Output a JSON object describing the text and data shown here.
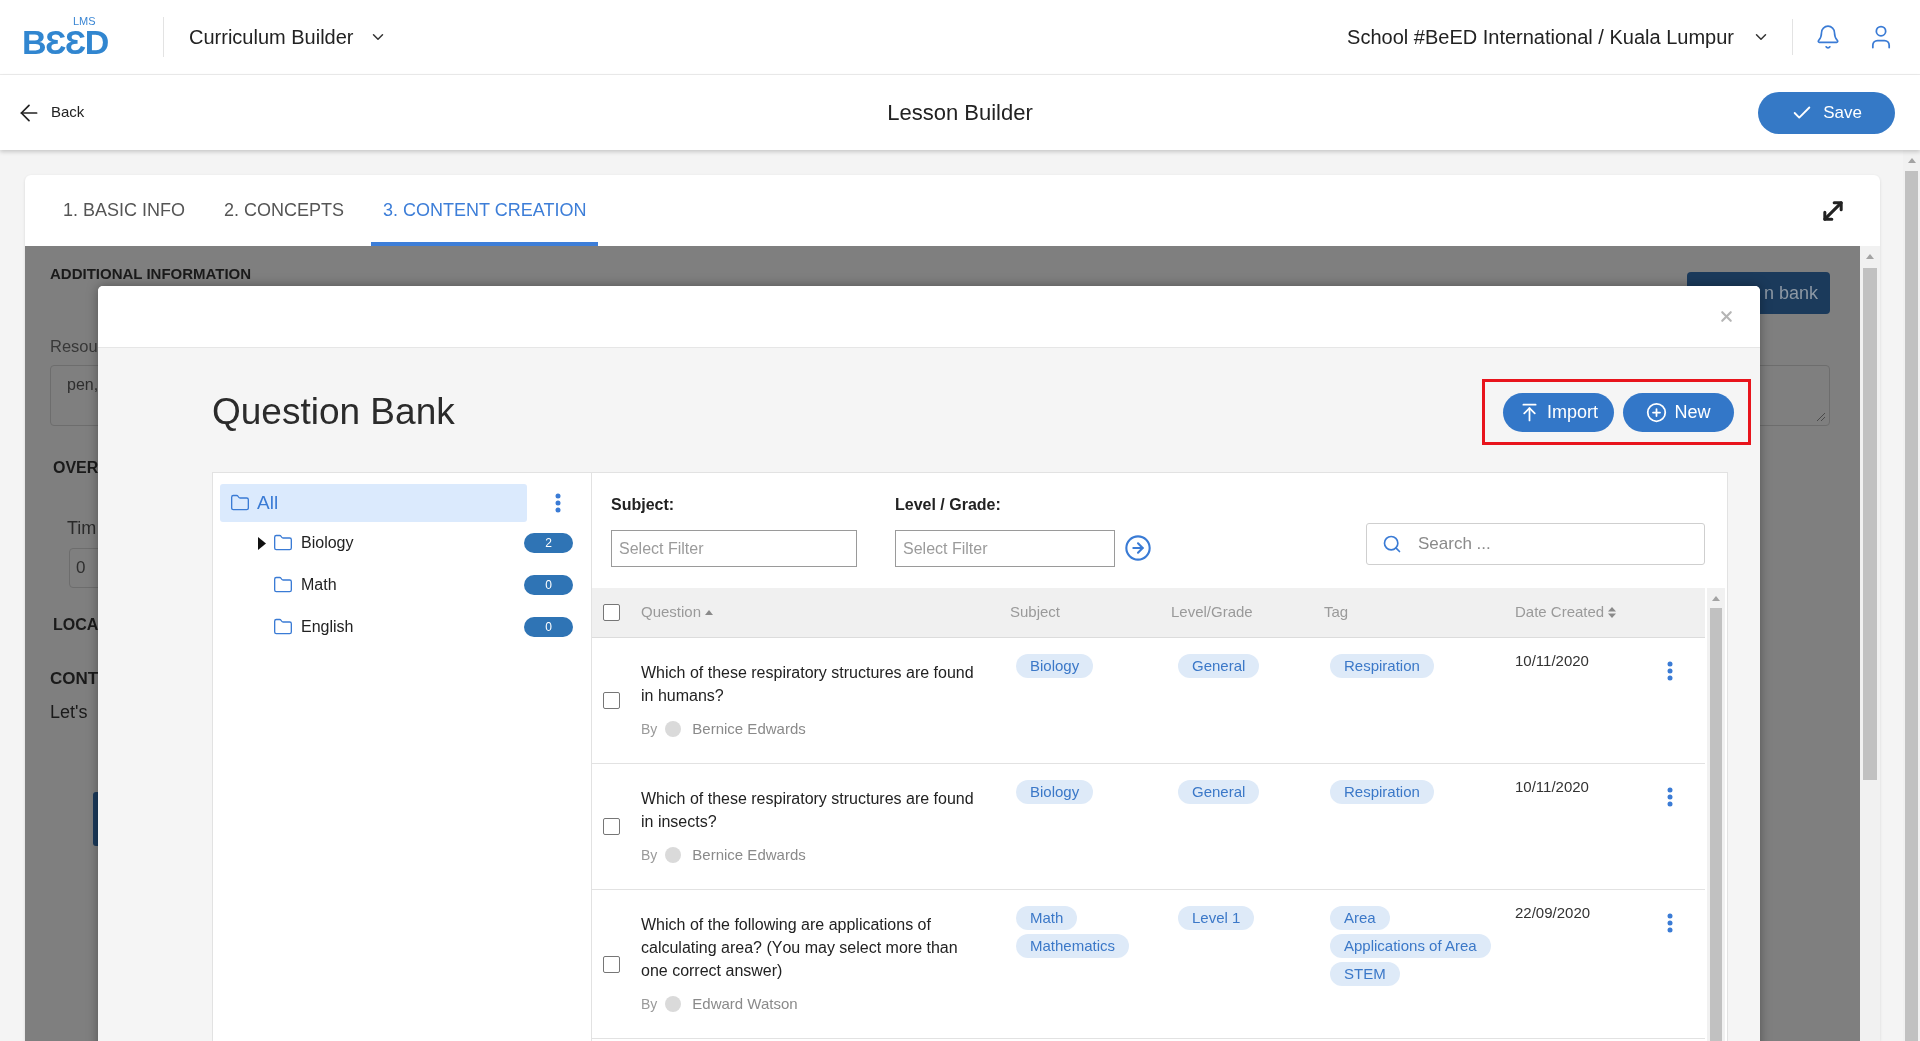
{
  "app_bar": {
    "logo_tag": "LMS",
    "logo_text": "BƐƐD",
    "module": "Curriculum Builder",
    "school": "School #BeED International / Kuala Lumpur"
  },
  "toolbar": {
    "back": "Back",
    "title": "Lesson Builder",
    "save": "Save"
  },
  "tabs": [
    {
      "label": "1. BASIC INFO",
      "selected": false
    },
    {
      "label": "2. CONCEPTS",
      "selected": false
    },
    {
      "label": "3. CONTENT CREATION",
      "selected": true
    }
  ],
  "background_form": {
    "section_title": "ADDITIONAL INFORMATION",
    "button": "n bank",
    "resources_label": "Resou",
    "resources_value": "pen,",
    "overall_label": "OVER",
    "time_label": "Tim",
    "time_value": "0",
    "location_label": "LOCA",
    "content_label": "CONT",
    "content_text": "Let's"
  },
  "modal": {
    "title": "Question Bank",
    "actions": [
      {
        "kind": "import",
        "label": "Import"
      },
      {
        "kind": "new",
        "label": "New"
      }
    ],
    "folder_tree": [
      {
        "label": "All",
        "selected": true,
        "children": [
          {
            "label": "Biology",
            "kind": "branch",
            "expanded": false,
            "selected": false,
            "count": "2"
          },
          {
            "label": "Math",
            "kind": "leaf",
            "selected": false,
            "count": "0"
          },
          {
            "label": "English",
            "kind": "leaf",
            "selected": false,
            "count": "0"
          }
        ]
      }
    ],
    "filters": [
      {
        "label": "Subject:",
        "placeholder": "Select Filter"
      },
      {
        "label": "Level / Grade:",
        "placeholder": "Select Filter"
      }
    ],
    "search": {
      "placeholder": "Search ..."
    },
    "table": {
      "header_checked": false,
      "columns": [
        {
          "label": "Question",
          "kind": "sorted_ascending"
        },
        {
          "label": "Subject",
          "kind": "plain"
        },
        {
          "label": "Level/Grade",
          "kind": "plain"
        },
        {
          "label": "Tag",
          "kind": "plain"
        },
        {
          "label": "Date Created",
          "kind": "sortable"
        }
      ],
      "rows": [
        {
          "checked": false,
          "question": "Which of these respiratory structures are found in humans?",
          "by": "By",
          "author": "Bernice Edwards",
          "subjects": [
            "Biology"
          ],
          "levels": [
            "General"
          ],
          "tags": [
            "Respiration"
          ],
          "date": "10/11/2020"
        },
        {
          "checked": false,
          "question": "Which of these respiratory structures are found in insects?",
          "by": "By",
          "author": "Bernice Edwards",
          "subjects": [
            "Biology"
          ],
          "levels": [
            "General"
          ],
          "tags": [
            "Respiration"
          ],
          "date": "10/11/2020"
        },
        {
          "checked": false,
          "question": "Which of the following are applications of calculating area? (You may select more than one correct answer)",
          "by": "By",
          "author": "Edward Watson",
          "subjects": [
            "Math",
            "Mathematics"
          ],
          "levels": [
            "Level 1"
          ],
          "tags": [
            "Area",
            "Applications of Area",
            "STEM"
          ],
          "date": "22/09/2020"
        }
      ]
    }
  }
}
